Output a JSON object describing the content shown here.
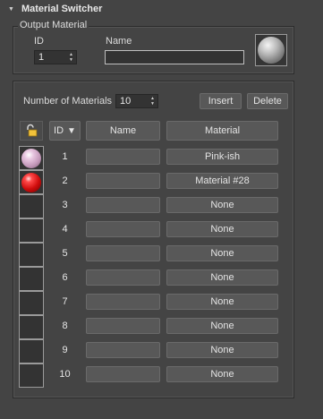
{
  "rollout": {
    "title": "Material Switcher",
    "arrow": "▼"
  },
  "output": {
    "group_label": "Output Material",
    "id_label": "ID",
    "id_value": "1",
    "name_label": "Name",
    "name_value": "",
    "swatch_icon": "material-sphere-icon"
  },
  "list": {
    "count_label": "Number of Materials",
    "count_value": "10",
    "insert_label": "Insert",
    "delete_label": "Delete",
    "headers": {
      "id": "ID",
      "sort_arrow": "▼",
      "name": "Name",
      "material": "Material"
    },
    "rows": [
      {
        "id": "1",
        "name": "",
        "material": "Pink-ish",
        "swatch": "pink"
      },
      {
        "id": "2",
        "name": "",
        "material": "Material #28",
        "swatch": "red"
      },
      {
        "id": "3",
        "name": "",
        "material": "None",
        "swatch": "empty"
      },
      {
        "id": "4",
        "name": "",
        "material": "None",
        "swatch": "empty"
      },
      {
        "id": "5",
        "name": "",
        "material": "None",
        "swatch": "empty"
      },
      {
        "id": "6",
        "name": "",
        "material": "None",
        "swatch": "empty"
      },
      {
        "id": "7",
        "name": "",
        "material": "None",
        "swatch": "empty"
      },
      {
        "id": "8",
        "name": "",
        "material": "None",
        "swatch": "empty"
      },
      {
        "id": "9",
        "name": "",
        "material": "None",
        "swatch": "empty"
      },
      {
        "id": "10",
        "name": "",
        "material": "None",
        "swatch": "empty"
      }
    ]
  },
  "colors": {
    "panel_bg": "#444444",
    "button_bg": "#585858",
    "field_bg": "#333333"
  }
}
